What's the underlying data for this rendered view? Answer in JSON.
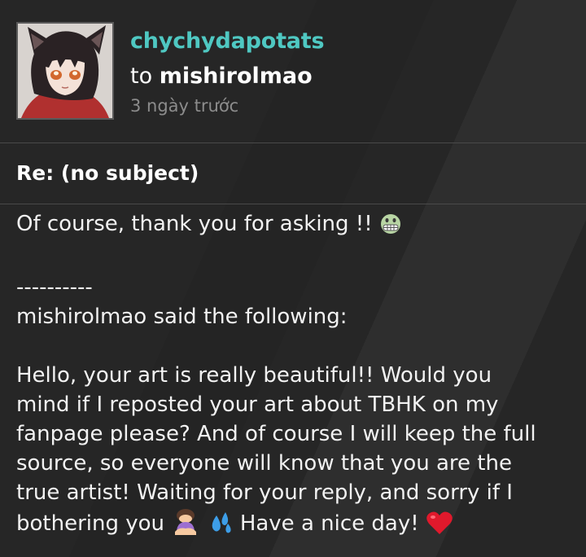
{
  "message": {
    "sender": "chychydapotats",
    "to_word": "to",
    "recipient": "mishirolmao",
    "timestamp": "3 ngày trước",
    "subject": "Re: (no subject)",
    "reply_text": "Of course, thank you for asking !!",
    "separator": "----------",
    "quote_intro": "mishirolmao said the following:",
    "quote_lines": [
      "Hello, your art is really beautiful!! Would you",
      "mind if I reposted your art about TBHK on my",
      "fanpage please? And of course I will keep the full",
      "source, so everyone will know that you are the",
      "true artist! Waiting for your reply, and sorry if I"
    ],
    "last_line_start": "bothering you",
    "last_line_end": "Have a nice day!"
  },
  "icons": {
    "avatar": "anime-cat-girl-avatar",
    "reply_emoji": "grimacing-face-emoji",
    "emoji_1": "woman-bowing-emoji",
    "emoji_2": "sweat-droplets-emoji",
    "emoji_3": "red-heart-emoji"
  },
  "colors": {
    "background": "#262626",
    "sender": "#4fc8c2",
    "timestamp": "#8c8c8c",
    "divider": "#4a4a4a"
  }
}
